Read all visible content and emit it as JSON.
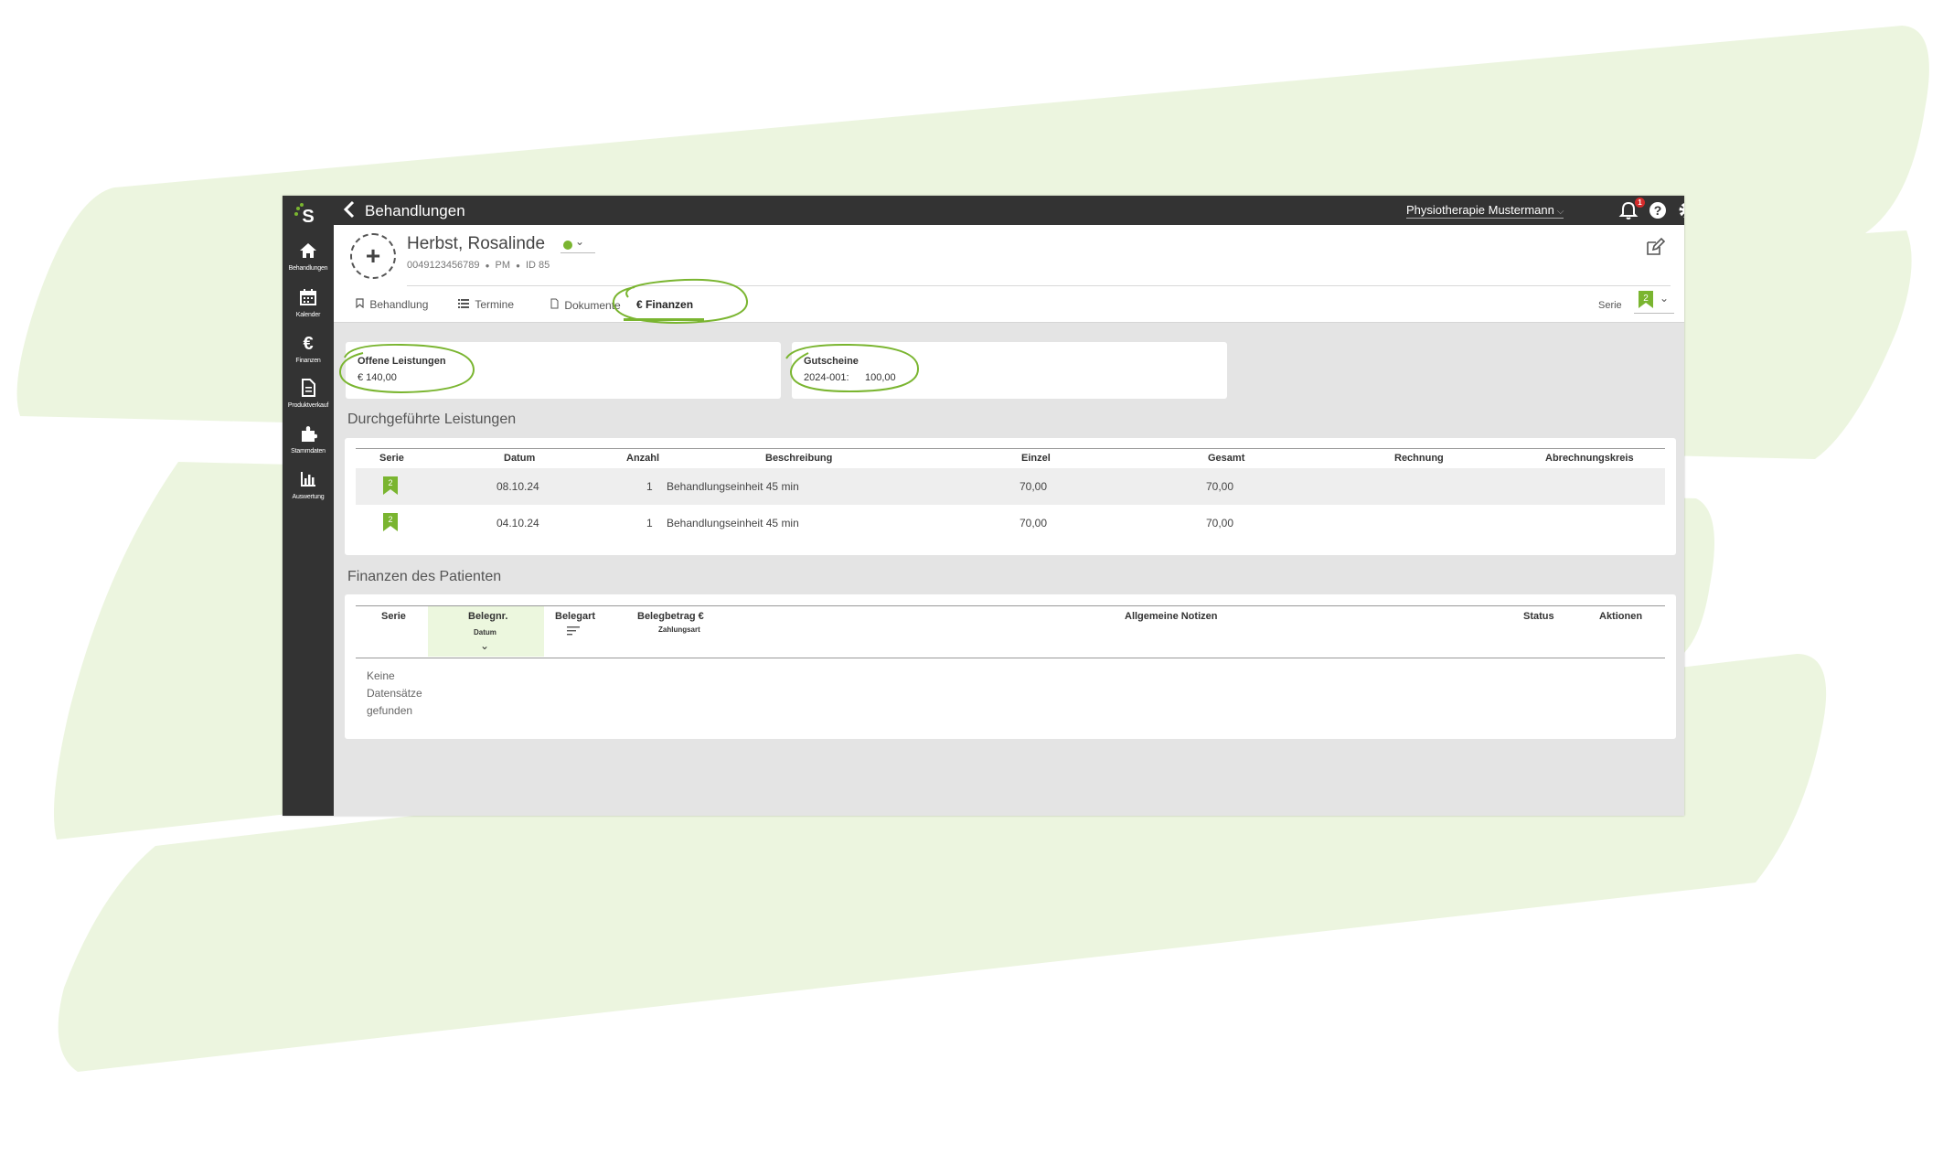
{
  "colors": {
    "accent": "#7ab530",
    "dark": "#333333",
    "bg_swoosh": "#ecf5df",
    "badge": "#d42b2b"
  },
  "sidebar": {
    "logo": "S",
    "items": [
      {
        "label": "Behandlungen",
        "icon": "home-icon"
      },
      {
        "label": "Kalender",
        "icon": "calendar-icon"
      },
      {
        "label": "Finanzen",
        "icon": "euro-icon"
      },
      {
        "label": "Produktverkauf",
        "icon": "document-icon"
      },
      {
        "label": "Stammdaten",
        "icon": "puzzle-icon"
      },
      {
        "label": "Auswertung",
        "icon": "bar-chart-icon"
      }
    ]
  },
  "topbar": {
    "title": "Behandlungen",
    "practice": "Physiotherapie Mustermann",
    "notification_count": "1"
  },
  "patient": {
    "name": "Herbst, Rosalinde",
    "phone": "0049123456789",
    "initials": "PM",
    "id": "ID 85"
  },
  "tabs": [
    {
      "label": "Behandlung",
      "icon": "bookmark-icon"
    },
    {
      "label": "Termine",
      "icon": "list-icon"
    },
    {
      "label": "Dokumente",
      "icon": "file-icon"
    },
    {
      "label": "Finanzen",
      "icon": "euro-icon",
      "active": true
    }
  ],
  "serie_filter": {
    "label": "Serie",
    "value": "2"
  },
  "summary": {
    "open": {
      "title": "Offene Leistungen",
      "value": "€ 140,00"
    },
    "vouchers": {
      "title": "Gutscheine",
      "code": "2024-001:",
      "amount": "100,00"
    }
  },
  "services": {
    "title": "Durchgeführte Leistungen",
    "columns": [
      "Serie",
      "Datum",
      "Anzahl",
      "Beschreibung",
      "Einzel",
      "Gesamt",
      "Rechnung",
      "Abrechnungskreis"
    ],
    "rows": [
      {
        "serie": "2",
        "datum": "08.10.24",
        "anzahl": "1",
        "beschreibung": "Behandlungseinheit 45 min",
        "einzel": "70,00",
        "gesamt": "70,00",
        "rechnung": "",
        "kreis": ""
      },
      {
        "serie": "2",
        "datum": "04.10.24",
        "anzahl": "1",
        "beschreibung": "Behandlungseinheit 45 min",
        "einzel": "70,00",
        "gesamt": "70,00",
        "rechnung": "",
        "kreis": ""
      }
    ]
  },
  "finances": {
    "title": "Finanzen des Patienten",
    "columns": {
      "serie": "Serie",
      "belegnr": "Belegnr.",
      "belegnr_sub": "Datum",
      "belegart": "Belegart",
      "betrag": "Belegbetrag €",
      "betrag_sub": "Zahlungsart",
      "notizen": "Allgemeine Notizen",
      "status": "Status",
      "aktionen": "Aktionen"
    },
    "empty": "Keine Datensätze gefunden"
  }
}
